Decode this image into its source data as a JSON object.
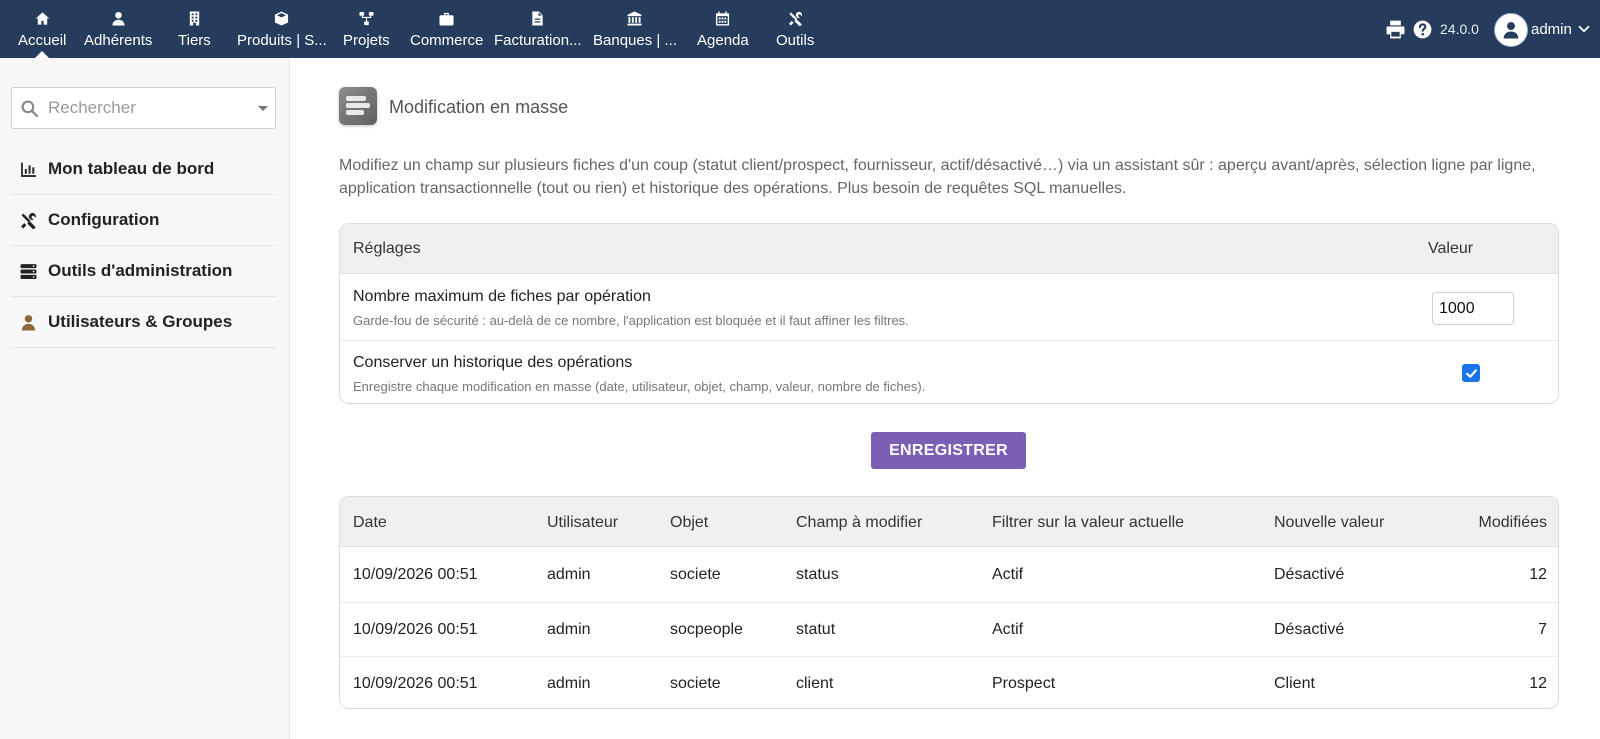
{
  "nav": {
    "items": [
      {
        "label": "Accueil",
        "icon": "home-icon"
      },
      {
        "label": "Adhérents",
        "icon": "user-icon"
      },
      {
        "label": "Tiers",
        "icon": "building-icon"
      },
      {
        "label": "Produits | S...",
        "icon": "cube-icon"
      },
      {
        "label": "Projets",
        "icon": "sitemap-icon"
      },
      {
        "label": "Commerce",
        "icon": "briefcase-icon"
      },
      {
        "label": "Facturation...",
        "icon": "file-invoice-icon"
      },
      {
        "label": "Banques | ...",
        "icon": "bank-icon"
      },
      {
        "label": "Agenda",
        "icon": "calendar-icon"
      },
      {
        "label": "Outils",
        "icon": "tools-icon"
      }
    ],
    "version": "24.0.0",
    "user": "admin"
  },
  "sidebar": {
    "search_placeholder": "Rechercher",
    "items": [
      {
        "label": "Mon tableau de bord",
        "icon": "chart-icon"
      },
      {
        "label": "Configuration",
        "icon": "tools-icon"
      },
      {
        "label": "Outils d'administration",
        "icon": "server-icon"
      },
      {
        "label": "Utilisateurs & Groupes",
        "icon": "user-icon"
      }
    ]
  },
  "page": {
    "title": "Modification en masse",
    "intro": "Modifiez un champ sur plusieurs fiches d'un coup (statut client/prospect, fournisseur, actif/désactivé…) via un assistant sûr : aperçu avant/après, sélection ligne par ligne, application transactionnelle (tout ou rien) et historique des opérations. Plus besoin de requêtes SQL manuelles."
  },
  "settings": {
    "header_label": "Réglages",
    "header_value": "Valeur",
    "rows": [
      {
        "title": "Nombre maximum de fiches par opération",
        "desc": "Garde-fou de sécurité : au-delà de ce nombre, l'application est bloquée et il faut affiner les filtres.",
        "value": "1000"
      },
      {
        "title": "Conserver un historique des opérations",
        "desc": "Enregistre chaque modification en masse (date, utilisateur, objet, champ, valeur, nombre de fiches).",
        "checked": true
      }
    ],
    "save_label": "ENREGISTRER"
  },
  "history": {
    "columns": [
      "Date",
      "Utilisateur",
      "Objet",
      "Champ à modifier",
      "Filtrer sur la valeur actuelle",
      "Nouvelle valeur",
      "Modifiées"
    ],
    "rows": [
      [
        "10/09/2026 00:51",
        "admin",
        "societe",
        "status",
        "Actif",
        "Désactivé",
        "12"
      ],
      [
        "10/09/2026 00:51",
        "admin",
        "socpeople",
        "statut",
        "Actif",
        "Désactivé",
        "7"
      ],
      [
        "10/09/2026 00:51",
        "admin",
        "societe",
        "client",
        "Prospect",
        "Client",
        "12"
      ]
    ]
  },
  "colors": {
    "topbar": "#263c5c",
    "button": "#7b5fb4",
    "checkbox": "#1a73e8",
    "user_icon": "#8a6a3a"
  }
}
